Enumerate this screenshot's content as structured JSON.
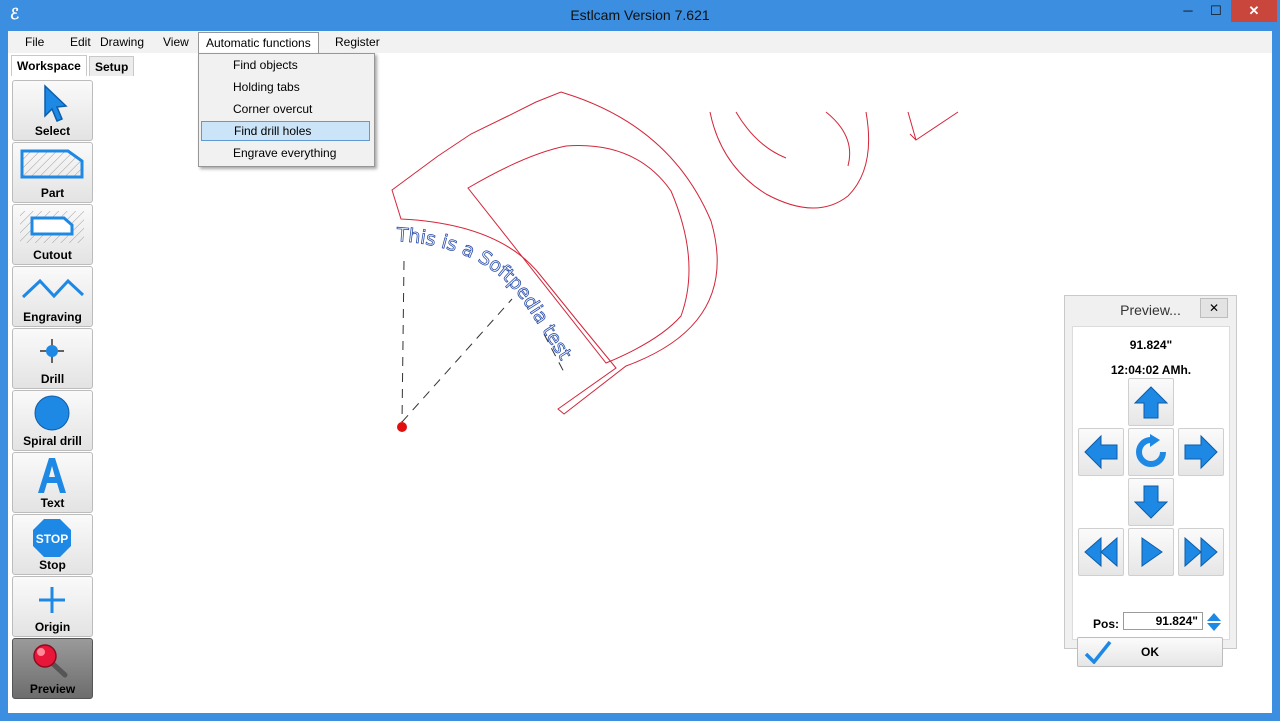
{
  "window": {
    "title": "Estlcam Version 7.621",
    "min": "─",
    "max": "☐",
    "close": "✕"
  },
  "menu": [
    "File",
    "Edit",
    "Drawing",
    "View",
    "Automatic functions",
    "Register"
  ],
  "dropdown": [
    "Find objects",
    "Holding tabs",
    "Corner overcut",
    "Find drill holes",
    "Engrave everything"
  ],
  "tabs": [
    "Workspace",
    "Setup"
  ],
  "tools": [
    {
      "label": "Select",
      "icon": "arrow-pointer-icon"
    },
    {
      "label": "Part",
      "icon": "part-icon"
    },
    {
      "label": "Cutout",
      "icon": "cutout-icon"
    },
    {
      "label": "Engraving",
      "icon": "engraving-zigzag-icon"
    },
    {
      "label": "Drill",
      "icon": "drill-crosshair-icon"
    },
    {
      "label": "Spiral drill",
      "icon": "spiral-drill-circle-icon"
    },
    {
      "label": "Text",
      "icon": "text-a-icon"
    },
    {
      "label": "Stop",
      "icon": "stop-sign-icon"
    },
    {
      "label": "Origin",
      "icon": "origin-plus-icon"
    },
    {
      "label": "Preview",
      "icon": "magnifier-icon"
    }
  ],
  "canvas": {
    "engraved_text": "This is a Softpedia test",
    "stop_text": "STOP"
  },
  "preview": {
    "title": "Preview...",
    "close": "✕",
    "distance": "91.824\"",
    "time": "12:04:02 AMh.",
    "pos_label": "Pos:",
    "pos_value": "91.824\"",
    "ok": "OK"
  },
  "colors": {
    "titlebar": "#3b8ee0",
    "accent": "#1e88e5",
    "contour": "#d3263a",
    "drill_point": "#e01010",
    "text_path": "#2b4ea8",
    "close": "#c9463d"
  }
}
